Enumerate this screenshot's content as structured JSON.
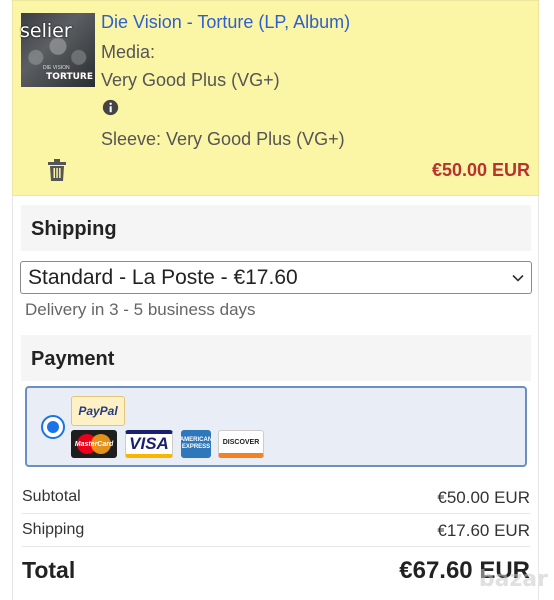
{
  "item": {
    "seller": "selier",
    "cover_title": "TORTURE",
    "cover_band": "DIE VISION",
    "title": "Die Vision - Torture (LP, Album)",
    "media_label": "Media:",
    "media_value": "Very Good Plus (VG+)",
    "sleeve": "Sleeve: Very Good Plus (VG+)",
    "price": "€50.00 EUR",
    "icons": {
      "info": "info-icon",
      "delete": "trash-icon"
    }
  },
  "shipping": {
    "heading": "Shipping",
    "selected_option": "Standard - La Poste - €17.60",
    "delivery_note": "Delivery in 3 - 5 business days"
  },
  "payment": {
    "heading": "Payment",
    "methods": {
      "paypal": "PayPal",
      "mastercard": "MasterCard",
      "visa": "VISA",
      "amex": "AMERICAN EXPRESS",
      "discover": "DISCOVER"
    }
  },
  "summary": {
    "subtotal_label": "Subtotal",
    "subtotal_value": "€50.00 EUR",
    "shipping_label": "Shipping",
    "shipping_value": "€17.60 EUR",
    "total_label": "Total",
    "total_value": "€67.60 EUR"
  },
  "watermark": "bazar",
  "colors": {
    "item_bg": "#fbf5a6",
    "price": "#b83232",
    "link": "#2e5fd0",
    "accent": "#1a73e8"
  }
}
